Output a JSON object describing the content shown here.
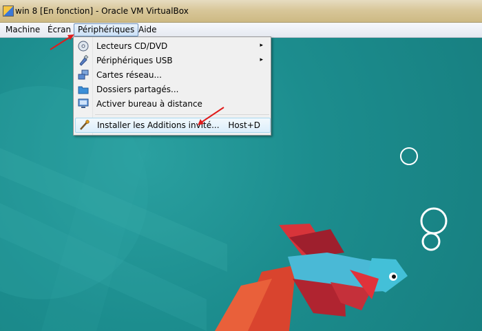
{
  "window": {
    "title": "win 8 [En fonction] - Oracle VM VirtualBox",
    "icon": "virtualbox-app-icon"
  },
  "menubar": {
    "items": [
      {
        "label": "Machine"
      },
      {
        "label": "Écran"
      },
      {
        "label": "Périphériques"
      },
      {
        "label": "Aide"
      }
    ]
  },
  "dropdown": {
    "items": [
      {
        "label": "Lecteurs CD/DVD",
        "icon": "cd-dvd-icon",
        "submenu": true
      },
      {
        "label": "Périphériques USB",
        "icon": "usb-icon",
        "submenu": true
      },
      {
        "label": "Cartes réseau...",
        "icon": "network-icon",
        "submenu": false
      },
      {
        "label": "Dossiers partagés...",
        "icon": "folder-icon",
        "submenu": false
      },
      {
        "label": "Activer bureau à distance",
        "icon": "remote-desktop-icon",
        "submenu": false
      },
      {
        "label": "Installer les Additions invité...",
        "icon": "install-tool-icon",
        "shortcut": "Host+D",
        "highlighted": true
      }
    ],
    "submenu_arrow": "▸"
  },
  "colors": {
    "desktop": "#1a8f8f",
    "annotation_arrow": "#e01b1b",
    "fish_body": "#4ab9d6",
    "fish_fin": "#b02430"
  }
}
